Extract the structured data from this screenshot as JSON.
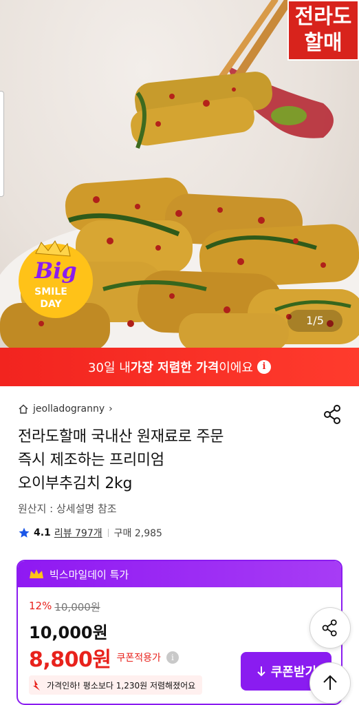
{
  "hero": {
    "brand_stamp_line1": "전라도",
    "brand_stamp_line2": "할매",
    "badge_line1": "Big",
    "badge_line2": "SMILE",
    "badge_line3": "DAY",
    "image_counter": "1/5"
  },
  "banner": {
    "prefix": "30일 내 ",
    "highlight": "가장 저렴한 가격",
    "suffix": "이에요",
    "info_glyph": "i"
  },
  "product": {
    "seller": "jeolladogranny",
    "seller_chevron": "›",
    "title_line1": "전라도할매 국내산 원재료로 주문",
    "title_line2": "즉시 제조하는 프리미엄",
    "title_line3": "오이부추김치  2kg",
    "origin": "원산지 : 상세설명 참조",
    "rating": "4.1",
    "review_label": "리뷰 797개",
    "purchase_label": "구매 2,985"
  },
  "promo": {
    "header": "빅스마일데이 특가",
    "discount_pct": "12%",
    "original_price": "10,000원",
    "sale_price": "10,000원",
    "coupon_price": "8,800원",
    "coupon_applied_label": "쿠폰적용가",
    "info_glyph": "i",
    "price_drop_note": "가격인하! 평소보다 1,230원 저렴해졌어요",
    "coupon_button": "쿠폰받기"
  },
  "colors": {
    "red": "#f2241f",
    "purple": "#8a1cf0",
    "star": "#1a56e8"
  },
  "icons": [
    "home-icon",
    "share-icon",
    "star-icon",
    "crown-icon",
    "arrow-down-icon",
    "arrow-up-icon",
    "info-icon"
  ]
}
